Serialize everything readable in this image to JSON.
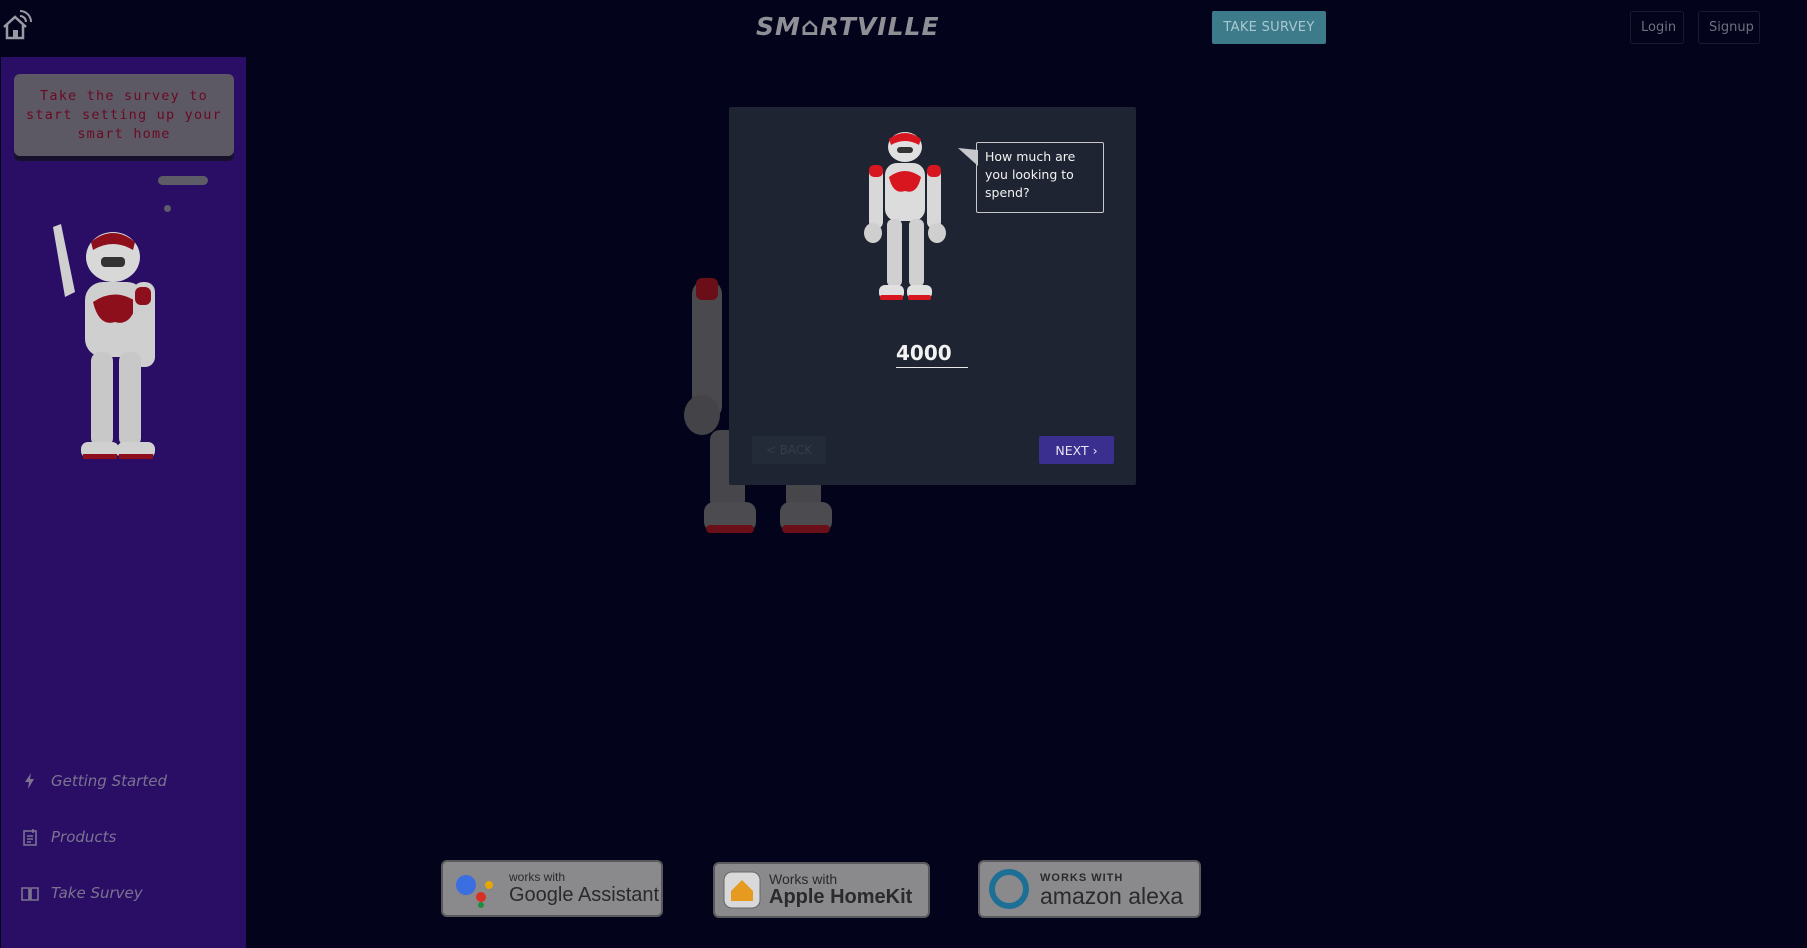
{
  "header": {
    "logo_text": "SM⌂RTVILLE",
    "take_survey_label": "TAKE SURVEY",
    "login_label": "Login",
    "signup_label": "Signup"
  },
  "sidebar": {
    "speech_text": "Take the survey to start setting up your smart home",
    "items": [
      {
        "label": "Getting Started",
        "icon": "bolt-icon"
      },
      {
        "label": "Products",
        "icon": "product-list-icon"
      },
      {
        "label": "Take Survey",
        "icon": "book-icon"
      }
    ]
  },
  "survey": {
    "question": "How much are you looking to spend?",
    "answer_value": "4000",
    "back_label": "< BACK",
    "next_label": "NEXT ›"
  },
  "badges": {
    "google": {
      "small": "works with",
      "big": "Google Assistant"
    },
    "apple": {
      "small": "Works with",
      "big": "Apple HomeKit"
    },
    "alexa": {
      "small": "WORKS WITH",
      "big": "amazon alexa"
    }
  },
  "colors": {
    "background": "#04031c",
    "sidebar": "#2a0e66",
    "accent_teal": "#3d7a8a",
    "next_button": "#3a2e8f",
    "modal": "#1f2432"
  }
}
